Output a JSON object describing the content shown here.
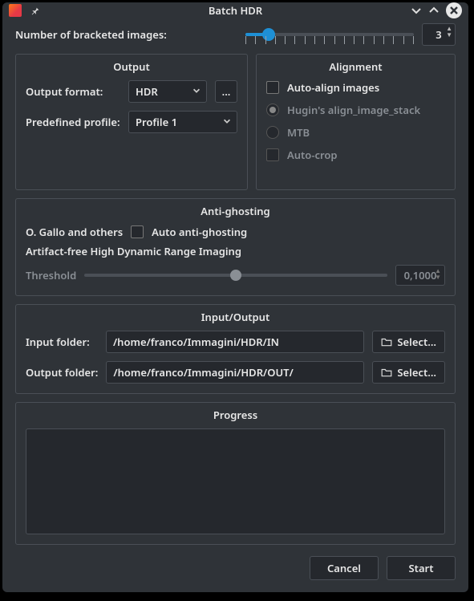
{
  "title": "Batch HDR",
  "bracket": {
    "label": "Number of bracketed images:",
    "value": "3",
    "min_pct": 14
  },
  "output": {
    "title": "Output",
    "format_label": "Output format:",
    "format_value": "HDR",
    "more_btn": "...",
    "profile_label": "Predefined profile:",
    "profile_value": "Profile 1"
  },
  "alignment": {
    "title": "Alignment",
    "auto_align": "Auto-align images",
    "hugin": "Hugin's align_image_stack",
    "mtb": "MTB",
    "auto_crop": "Auto-crop"
  },
  "ghost": {
    "title": "Anti-ghosting",
    "credit": "O. Gallo and others",
    "desc": "Artifact-free High Dynamic Range Imaging",
    "toggle": "Auto anti-ghosting",
    "threshold_label": "Threshold",
    "threshold_value": "0,1000"
  },
  "io": {
    "title": "Input/Output",
    "input_label": "Input folder:",
    "input_value": "/home/franco/Immagini/HDR/IN",
    "output_label": "Output folder:",
    "output_value": "/home/franco/Immagini/HDR/OUT/",
    "select_btn": "Select..."
  },
  "progress": {
    "title": "Progress"
  },
  "footer": {
    "cancel": "Cancel",
    "start": "Start"
  }
}
